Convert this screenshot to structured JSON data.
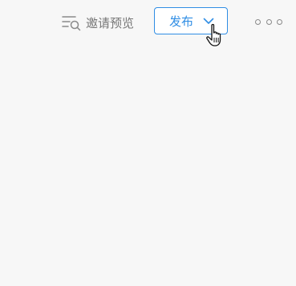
{
  "toolbar": {
    "invite_preview_label": "邀请预览",
    "invite_preview_icon": "filter-search-icon",
    "publish_label": "发布",
    "publish_chevron_icon": "chevron-down-icon",
    "more_icon": "more-horizontal-icon",
    "cursor_icon": "hand-pointer-icon"
  },
  "colors": {
    "background": "#f7f7f7",
    "accent": "#2f8de4",
    "muted_text": "#777777"
  }
}
